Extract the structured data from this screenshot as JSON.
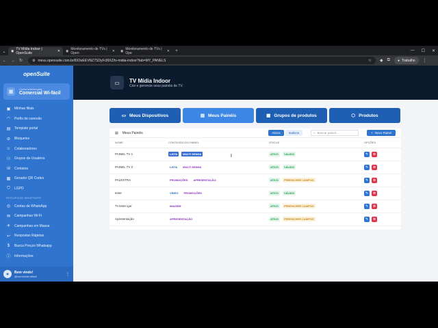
{
  "browser": {
    "tabs": [
      {
        "title": "TV Mídia Indoor | OpenSuite",
        "active": true
      },
      {
        "title": "Monitoramento de TVs | Open",
        "active": false
      },
      {
        "title": "Monitoramento de TVs | Ope",
        "active": false
      }
    ],
    "new_tab": "+",
    "url": "meus.opensuite.com.br/l0/2wEEVNZ7SDyFc8IXZ/tv-midia-indoor?tab=MY_PANELS",
    "profile_label": "Trabalho"
  },
  "sidebar": {
    "logo": "openSuite",
    "account_label": "Conta selecionada",
    "account_name": "Comercial Wi-fácil",
    "items": [
      {
        "label": "Minhas filiais",
        "icon": "store-icon"
      },
      {
        "label": "Perfis de conexão",
        "icon": "wifi-icon"
      },
      {
        "label": "Template portal",
        "icon": "template-icon"
      },
      {
        "label": "Bloqueios",
        "icon": "block-icon"
      },
      {
        "label": "Colaboradores",
        "icon": "users-icon"
      },
      {
        "label": "Grupos de Usuários",
        "icon": "group-icon"
      },
      {
        "label": "Contatos",
        "icon": "contacts-icon"
      },
      {
        "label": "Gerador QR Codes",
        "icon": "qr-icon"
      },
      {
        "label": "LGPD",
        "icon": "shield-icon"
      }
    ],
    "section_label": "RECURSOS WHATSAPP",
    "items2": [
      {
        "label": "Contas de WhatsApp",
        "icon": "whatsapp-icon"
      },
      {
        "label": "Campanhas Wi-Fi",
        "icon": "campaign-icon"
      },
      {
        "label": "Campanhas em Massa",
        "icon": "megaphone-icon"
      },
      {
        "label": "Respostas Rápidas",
        "icon": "reply-icon"
      },
      {
        "label": "Busca Preços Whatsapp",
        "icon": "price-icon"
      },
      {
        "label": "Informações",
        "icon": "info-icon"
      }
    ],
    "user_welcome": "Bem vindo!",
    "user_email": "@comercial.wifacil"
  },
  "header": {
    "title": "TV Mídia Indoor",
    "subtitle": "Crie e gerencie seus painéis de TV."
  },
  "main_tabs": [
    {
      "label": "Meus Dispositivos",
      "icon": "monitor-icon",
      "active": false
    },
    {
      "label": "Meus Painéis",
      "icon": "panel-icon",
      "active": true
    },
    {
      "label": "Grupos de produtos",
      "icon": "grid-icon",
      "active": false
    },
    {
      "label": "Produtos",
      "icon": "box-icon",
      "active": false
    }
  ],
  "panels": {
    "title": "Meus Painéis",
    "filter_active": "Ativos",
    "filter_inactive": "Inativos",
    "search_placeholder": "Buscar painel...",
    "new_button": "Novo Painel",
    "columns": [
      "NOME",
      "CONTEÚDO DO PAINEL",
      "STATUS",
      "OPÇÕES"
    ],
    "rows": [
      {
        "name": "PAINEL TV 1",
        "content": [
          "LISTA",
          "MULTI SENHA"
        ],
        "status": [
          "ATIVO",
          "VÁLIDO"
        ]
      },
      {
        "name": "PAINEL TV 2",
        "content": [
          "LISTA",
          "MULTI SENHA"
        ],
        "status": [
          "ATIVO",
          "VÁLIDO"
        ]
      },
      {
        "name": "PALESTRA",
        "content": [
          "PROMOÇÕES",
          "APRESENTAÇÃO"
        ],
        "status": [
          "ATIVO",
          "PREENCHER CAMPOS"
        ]
      },
      {
        "name": "teste",
        "content": [
          "VÍDEO",
          "PROMOÇÕES"
        ],
        "status": [
          "ATIVO",
          "VÁLIDO"
        ]
      },
      {
        "name": "Tv teste igor",
        "content": [
          "IMAGEM"
        ],
        "status": [
          "ATIVO",
          "PREENCHER CAMPOS"
        ]
      },
      {
        "name": "Apresentação",
        "content": [
          "APRESENTAÇÃO"
        ],
        "status": [
          "ATIVO",
          "PREENCHER CAMPOS"
        ]
      }
    ]
  }
}
